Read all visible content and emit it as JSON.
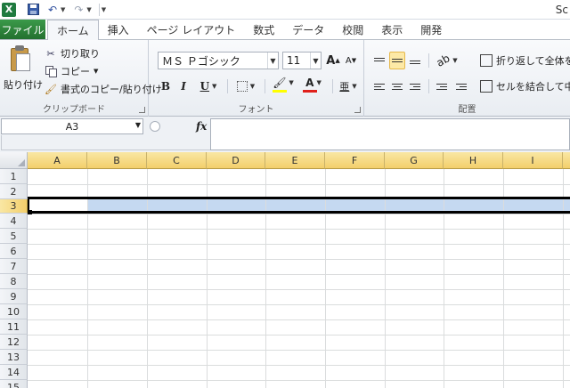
{
  "window": {
    "title": "Sc"
  },
  "tabs": {
    "file": "ファイル",
    "items": [
      "ホーム",
      "挿入",
      "ページ レイアウト",
      "数式",
      "データ",
      "校閲",
      "表示",
      "開発"
    ],
    "active_index": 0
  },
  "ribbon": {
    "clipboard": {
      "paste": "貼り付け",
      "cut": "切り取り",
      "copy": "コピー",
      "format_painter": "書式のコピー/貼り付け",
      "group_label": "クリップボード"
    },
    "font": {
      "font_name": "ＭＳ Ｐゴシック",
      "font_size": "11",
      "bold": "B",
      "italic": "I",
      "underline": "U",
      "grow": "A",
      "shrink": "A",
      "font_color_letter": "A",
      "phonetic": "亜",
      "group_label": "フォント",
      "font_color": "#e0201b",
      "fill_color": "#ffff00"
    },
    "alignment": {
      "wrap_text": "折り返して全体を表",
      "merge_center": "セルを結合して中央",
      "group_label": "配置",
      "selected": "middle-align"
    }
  },
  "formula_bar": {
    "name_box": "A3",
    "fx": "fx",
    "value": ""
  },
  "sheet": {
    "columns": [
      "A",
      "B",
      "C",
      "D",
      "E",
      "F",
      "G",
      "H",
      "I"
    ],
    "rows": [
      "1",
      "2",
      "3",
      "4",
      "5",
      "6",
      "7",
      "8",
      "9",
      "10",
      "11",
      "12",
      "13",
      "14",
      "15"
    ],
    "selected_row": "3",
    "active_cell": "A3",
    "selection_color": "#c5d9f1"
  }
}
